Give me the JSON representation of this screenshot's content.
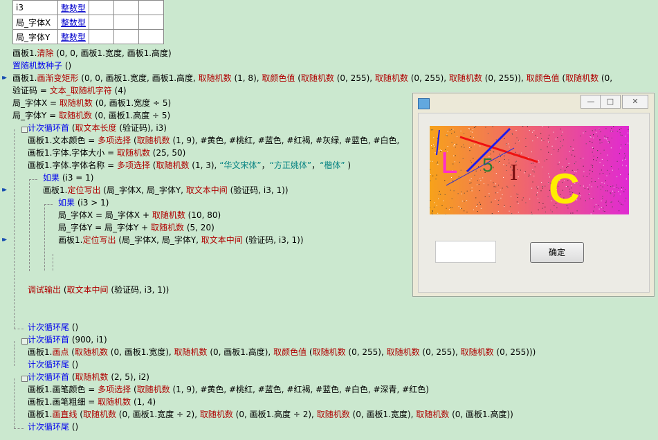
{
  "var_table": [
    {
      "name": "i3",
      "type": "整数型"
    },
    {
      "name": "局_字体X",
      "type": "整数型"
    },
    {
      "name": "局_字体Y",
      "type": "整数型"
    }
  ],
  "code_lines": [
    [
      "画板1.",
      "清除",
      " (0, 0, 画板1.宽度, 画板1.高度)"
    ],
    [
      "置随机数种子",
      " ()"
    ],
    [
      "画板1.",
      "画渐变矩形",
      " (0, 0, 画板1.宽度, 画板1.高度, ",
      "取随机数",
      " (1, 8), ",
      "取颜色值",
      " (",
      "取随机数",
      " (0, 255), ",
      "取随机数",
      " (0, 255), ",
      "取随机数",
      " (0, 255)), ",
      "取颜色值",
      " (",
      "取随机数",
      " (0,"
    ],
    [
      "验证码 = ",
      "文本_取随机字符",
      " (4)"
    ],
    [
      "局_字体X = ",
      "取随机数",
      " (0, 画板1.宽度 ÷ 5)"
    ],
    [
      "局_字体Y = ",
      "取随机数",
      " (0, 画板1.高度 ÷ 5)"
    ],
    [
      "计次循环首",
      " (",
      "取文本长度",
      " (验证码), i3)"
    ],
    [
      "画板1.文本颜色 = ",
      "多项选择",
      " (",
      "取随机数",
      " (1, 9), #黄色, #桃红, #蓝色, #红褐, #灰绿, #蓝色, #白色,"
    ],
    [
      "画板1.字体.字体大小 = ",
      "取随机数",
      " (25, 50)"
    ],
    [
      "画板1.字体.字体名称 = ",
      "多项选择",
      " (",
      "取随机数",
      " (1, 3), ",
      "“华文宋体”",
      "，",
      "“方正姚体”",
      "，",
      "“楷体”",
      " )"
    ],
    [
      "如果",
      " (i3 = 1)"
    ],
    [
      "画板1.",
      "定位写出",
      " (局_字体X, 局_字体Y, ",
      "取文本中间",
      " (验证码, i3, 1))"
    ],
    [
      "如果",
      " (i3 > 1)"
    ],
    [
      "局_字体X = 局_字体X + ",
      "取随机数",
      " (10, 80)"
    ],
    [
      "局_字体Y = 局_字体Y + ",
      "取随机数",
      " (5, 20)"
    ],
    [
      "画板1.",
      "定位写出",
      " (局_字体X, 局_字体Y, ",
      "取文本中间",
      " (验证码, i3, 1))"
    ],
    [
      "调试输出",
      " (",
      "取文本中间",
      " (验证码, i3, 1))"
    ],
    [
      "计次循环尾",
      " ()"
    ],
    [
      "计次循环首",
      " (900, i1)"
    ],
    [
      "画板1.",
      "画点",
      " (",
      "取随机数",
      " (0, 画板1.宽度), ",
      "取随机数",
      " (0, 画板1.高度), ",
      "取颜色值",
      " (",
      "取随机数",
      " (0, 255), ",
      "取随机数",
      " (0, 255), ",
      "取随机数",
      " (0, 255)))"
    ],
    [
      "计次循环尾",
      " ()"
    ],
    [
      "计次循环首",
      " (",
      "取随机数",
      " (2, 5), i2)"
    ],
    [
      "画板1.画笔颜色 = ",
      "多项选择",
      " (",
      "取随机数",
      " (1, 9), #黄色, #桃红, #蓝色, #红褐, #蓝色, #白色, #深青, #红色)"
    ],
    [
      "画板1.画笔粗细 = ",
      "取随机数",
      " (1, 4)"
    ],
    [
      "画板1.",
      "画直线",
      " (",
      "取随机数",
      " (0, 画板1.宽度 ÷ 2), ",
      "取随机数",
      " (0, 画板1.高度 ÷ 2), ",
      "取随机数",
      " (0, 画板1.宽度), ",
      "取随机数",
      " (0, 画板1.高度))"
    ],
    [
      "计次循环尾",
      " ()"
    ]
  ],
  "window": {
    "captcha_chars": [
      "L",
      "5",
      "I",
      "C"
    ],
    "captcha_colors": [
      "#ff2ecb",
      "#2e7d32",
      "#7a1010",
      "#ffee00"
    ],
    "input_value": "",
    "ok_label": "确定",
    "minimize_icon": "minimize-icon",
    "maximize_icon": "maximize-icon",
    "close_icon": "close-icon"
  },
  "colors": {
    "background": "#cbe8cf",
    "keyword": "#0000ee",
    "function": "#b00000",
    "string": "#008080",
    "type_link": "#0000cc"
  }
}
